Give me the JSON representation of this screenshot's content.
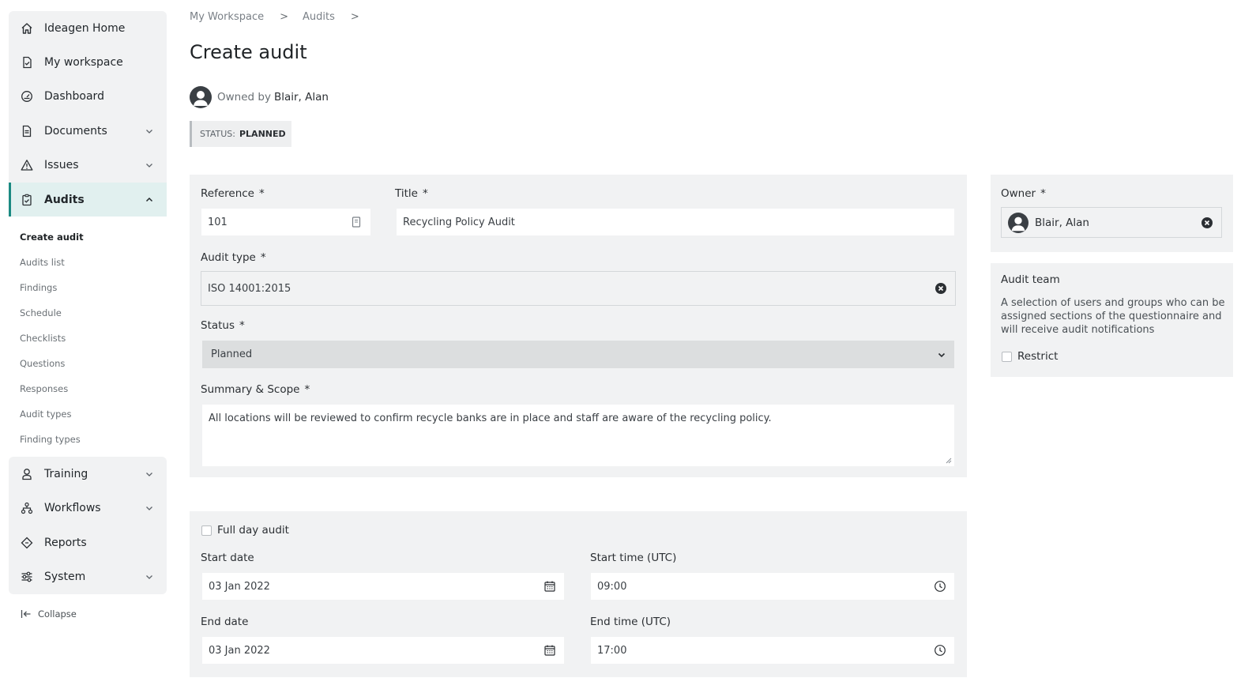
{
  "sidebar": {
    "top_items": [
      {
        "label": "Ideagen Home",
        "icon": "home-icon"
      },
      {
        "label": "My workspace",
        "icon": "workspace-icon"
      },
      {
        "label": "Dashboard",
        "icon": "dashboard-icon"
      },
      {
        "label": "Documents",
        "icon": "document-icon"
      },
      {
        "label": "Issues",
        "icon": "warning-icon"
      },
      {
        "label": "Audits",
        "icon": "clipboard-icon"
      }
    ],
    "sub_items": [
      "Create audit",
      "Audits list",
      "Findings",
      "Schedule",
      "Checklists",
      "Questions",
      "Responses",
      "Audit types",
      "Finding types"
    ],
    "bottom_items": [
      {
        "label": "Training",
        "icon": "training-icon"
      },
      {
        "label": "Workflows",
        "icon": "workflow-icon"
      },
      {
        "label": "Reports",
        "icon": "reports-icon"
      },
      {
        "label": "System",
        "icon": "sliders-icon"
      }
    ],
    "collapse_label": "Collapse"
  },
  "breadcrumb": {
    "items": [
      "My Workspace",
      "Audits"
    ],
    "separator": ">"
  },
  "page": {
    "title": "Create audit",
    "owned_by_prefix": "Owned by",
    "owner_name": "Blair, Alan",
    "status_label": "STATUS:",
    "status_value": "PLANNED"
  },
  "form": {
    "reference": {
      "label": "Reference",
      "value": "101"
    },
    "title": {
      "label": "Title",
      "value": "Recycling Policy Audit"
    },
    "audit_type": {
      "label": "Audit type",
      "value": "ISO 14001:2015"
    },
    "status": {
      "label": "Status",
      "value": "Planned"
    },
    "summary": {
      "label": "Summary & Scope",
      "value": "All locations will be reviewed to confirm recycle banks are in place and staff are aware of the recycling policy."
    },
    "required_mark": "*"
  },
  "schedule": {
    "full_day_label": "Full day audit",
    "start_date": {
      "label": "Start date",
      "value": "03 Jan 2022"
    },
    "start_time": {
      "label": "Start time (UTC)",
      "value": "09:00"
    },
    "end_date": {
      "label": "End date",
      "value": "03 Jan 2022"
    },
    "end_time": {
      "label": "End time (UTC)",
      "value": "17:00"
    }
  },
  "owner_panel": {
    "label": "Owner",
    "value": "Blair, Alan"
  },
  "team_panel": {
    "title": "Audit team",
    "description": "A selection of users and groups who can be assigned sections of the questionnaire and will receive audit notifications",
    "restrict_label": "Restrict"
  },
  "colors": {
    "accent": "#1b8a82",
    "panel": "#f1f2f3",
    "active_bg": "#e1f0ef"
  }
}
